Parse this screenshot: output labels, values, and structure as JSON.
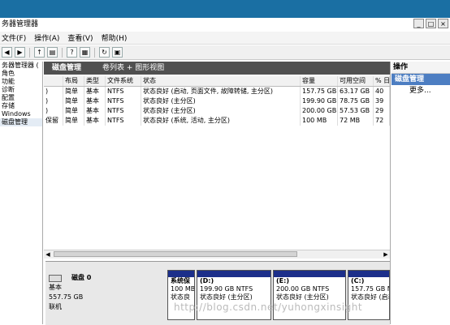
{
  "window": {
    "title": "务器管理器",
    "controls": [
      "_",
      "□",
      "×"
    ]
  },
  "menu": [
    "文件(F)",
    "操作(A)",
    "查看(V)",
    "帮助(H)"
  ],
  "tree": {
    "items": [
      "务器管理器 (",
      "角色",
      "功能",
      "诊断",
      "配置",
      "存储",
      "Windows",
      "磁盘管理"
    ]
  },
  "panel": {
    "title": "磁盘管理",
    "view_label": "卷列表 + 图形视图"
  },
  "table": {
    "columns": [
      "布局",
      "类型",
      "文件系统",
      "状态",
      "容量",
      "可用空间",
      "% 日"
    ],
    "rows": [
      {
        "vol": ")",
        "layout": "简单",
        "type": "基本",
        "fs": "NTFS",
        "status": "状态良好 (启动, 页面文件, 故障转储, 主分区)",
        "capacity": "157.75 GB",
        "free": "63.17 GB",
        "pct": "40"
      },
      {
        "vol": ")",
        "layout": "简单",
        "type": "基本",
        "fs": "NTFS",
        "status": "状态良好 (主分区)",
        "capacity": "199.90 GB",
        "free": "78.75 GB",
        "pct": "39"
      },
      {
        "vol": ")",
        "layout": "简单",
        "type": "基本",
        "fs": "NTFS",
        "status": "状态良好 (主分区)",
        "capacity": "200.00 GB",
        "free": "57.53 GB",
        "pct": "29"
      },
      {
        "vol": "保留",
        "layout": "简单",
        "type": "基本",
        "fs": "NTFS",
        "status": "状态良好 (系统, 活动, 主分区)",
        "capacity": "100 MB",
        "free": "72 MB",
        "pct": "72"
      }
    ]
  },
  "disk": {
    "name": "磁盘 0",
    "type": "基本",
    "size": "557.75 GB",
    "state": "联机",
    "volumes": [
      {
        "name": "系统保",
        "size": "100 MB",
        "status": "状态良"
      },
      {
        "name": "(D:)",
        "size": "199.90 GB NTFS",
        "status": "状态良好 (主分区)"
      },
      {
        "name": "(E:)",
        "size": "200.00 GB NTFS",
        "status": "状态良好 (主分区)"
      },
      {
        "name": "(C:)",
        "size": "157.75 GB NTFS",
        "status": "状态良好 (启动, 页面文件, 故障转储, 主分区)"
      }
    ]
  },
  "actions": {
    "header": "操作",
    "section": "磁盘管理",
    "more": "更多..."
  },
  "watermark": "http://blog.csdn.net/yuhongxinsight",
  "colors": {
    "titlebar": "#1a6fa3",
    "panel_header": "#505050",
    "volume_bar": "#1c2f8a",
    "action_section": "#4d7ec2"
  }
}
